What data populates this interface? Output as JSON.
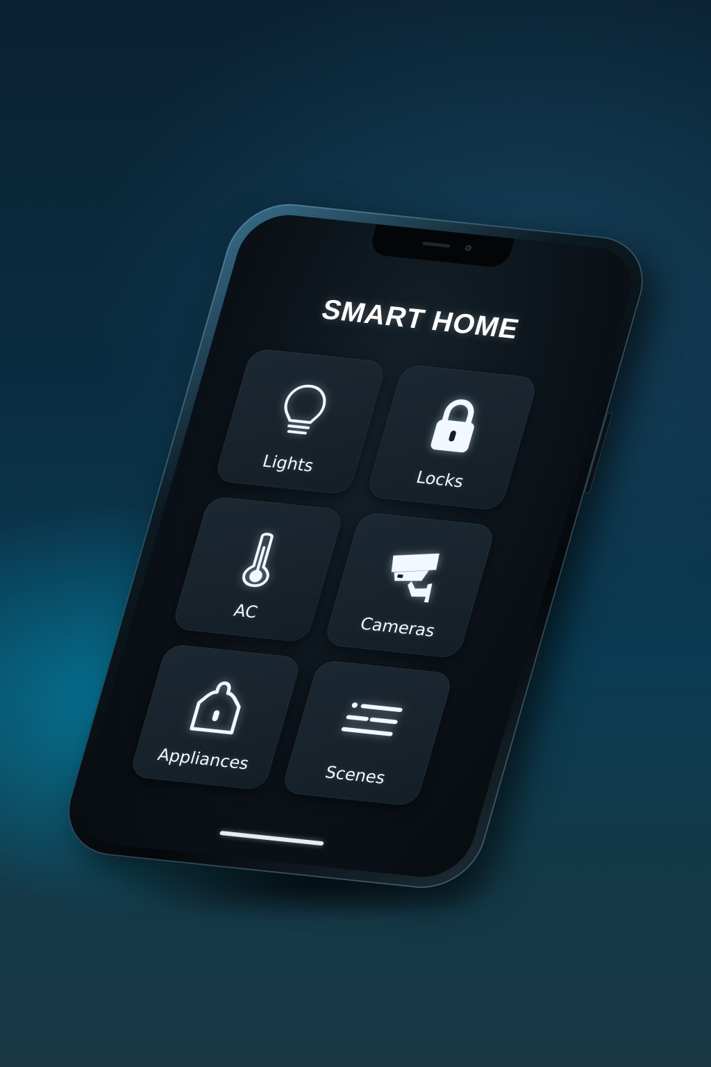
{
  "app": {
    "title": "SMART HOME"
  },
  "tiles": [
    {
      "label": "Lights",
      "icon": "lightbulb-icon"
    },
    {
      "label": "Locks",
      "icon": "padlock-icon"
    },
    {
      "label": "AC",
      "icon": "thermometer-icon"
    },
    {
      "label": "Cameras",
      "icon": "security-camera-icon"
    },
    {
      "label": "Appliances",
      "icon": "house-lock-icon"
    },
    {
      "label": "Scenes",
      "icon": "list-icon"
    }
  ],
  "colors": {
    "background_top": "#0a2233",
    "background_glow": "#00a0c8",
    "screen": "#0b1218",
    "tile": "#1a2530",
    "text": "#ffffff"
  }
}
